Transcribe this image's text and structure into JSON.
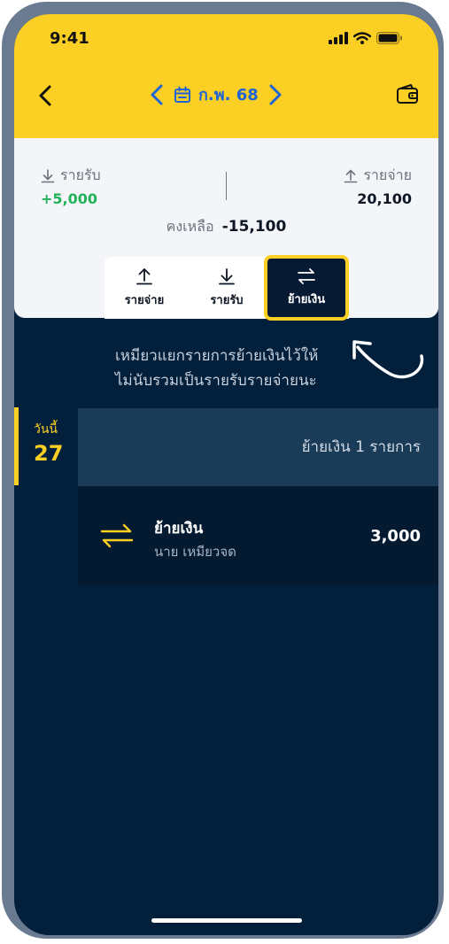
{
  "status": {
    "time": "9:41"
  },
  "header": {
    "month_label": "ก.พ. 68"
  },
  "summary": {
    "income_label": "รายรับ",
    "income_value": "+5,000",
    "expense_label": "รายจ่าย",
    "expense_value": "20,100",
    "balance_label": "คงเหลือ",
    "balance_value": "-15,100"
  },
  "tabs": [
    {
      "label": "รายจ่าย",
      "icon": "upload-arrow-icon"
    },
    {
      "label": "รายรับ",
      "icon": "download-arrow-icon"
    },
    {
      "label": "ย้ายเงิน",
      "icon": "swap-arrows-icon"
    }
  ],
  "hint": {
    "line1": "เหมียวแยกรายการย้ายเงินไว้ให้",
    "line2": "ไม่นับรวมเป็นรายรับรายจ่ายนะ"
  },
  "day": {
    "label": "วันนี้",
    "number": "27",
    "summary": "ย้ายเงิน 1 รายการ"
  },
  "transaction": {
    "title": "ย้ายเงิน",
    "subtitle": "นาย เหมียวจด",
    "amount": "3,000"
  },
  "colors": {
    "brand_yellow": "#fccf25",
    "navy": "#02203b",
    "accent_blue": "#1f64d6",
    "income_green": "#22b35a"
  }
}
